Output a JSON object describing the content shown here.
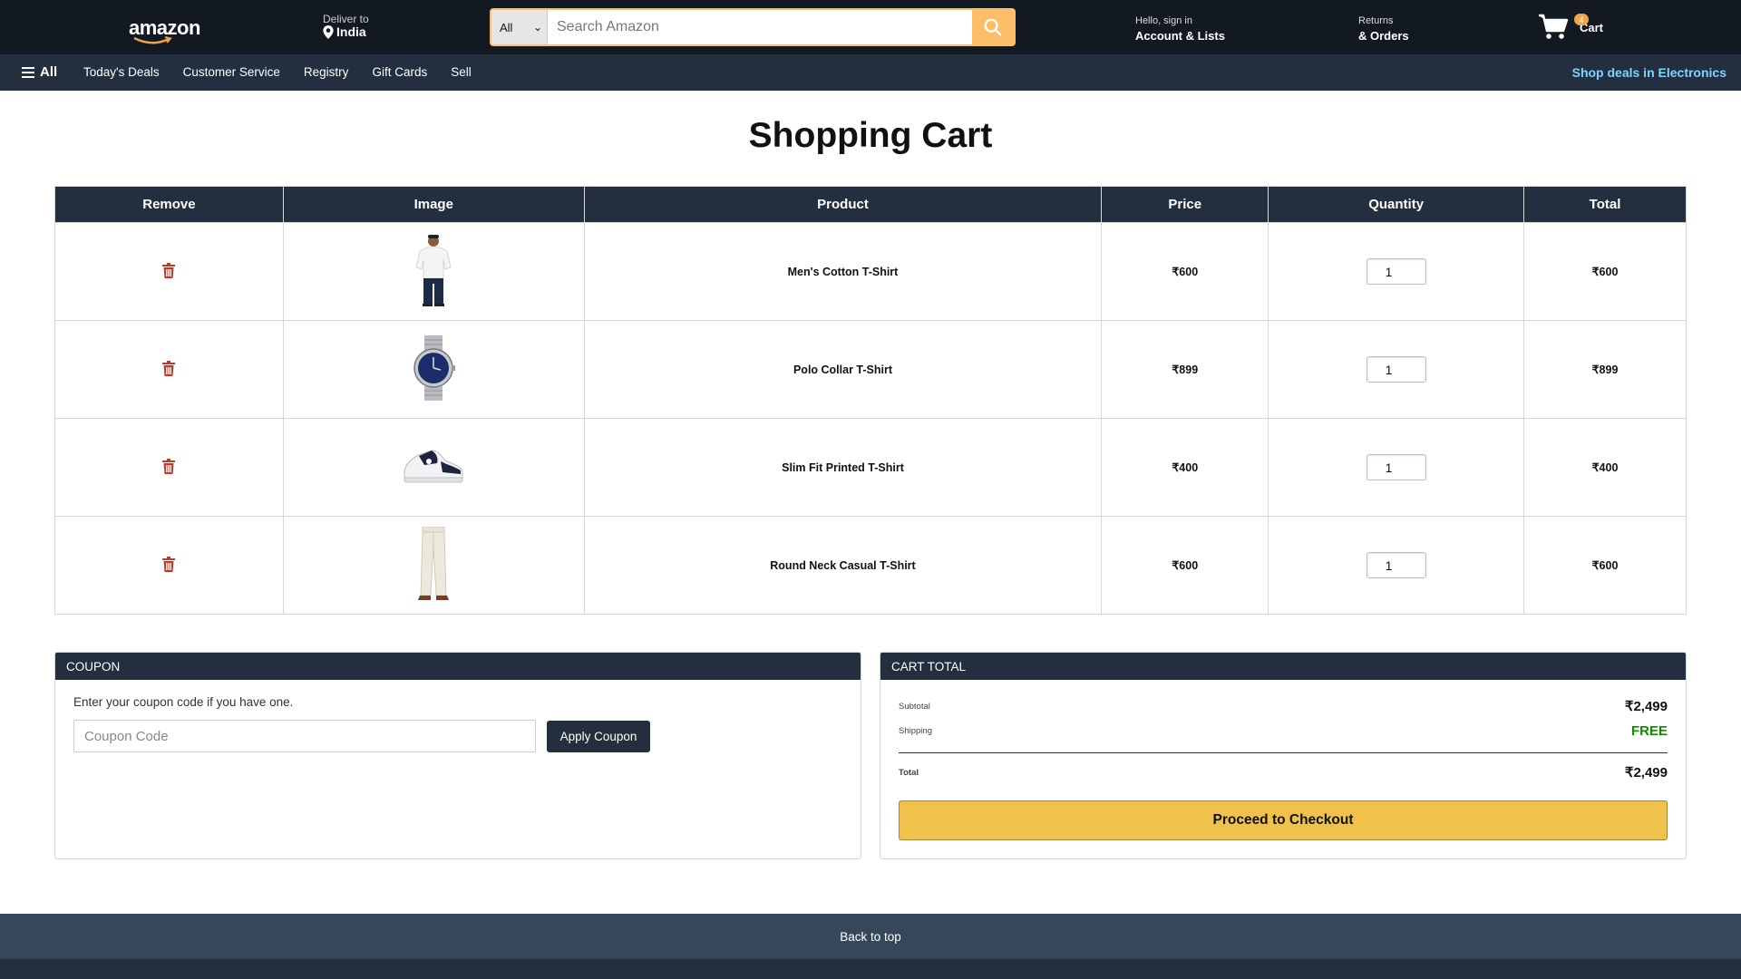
{
  "header": {
    "logo_text": "amazon",
    "deliver_small": "Deliver to",
    "deliver_location": "India",
    "search": {
      "category": "All",
      "placeholder": "Search Amazon"
    },
    "account_small": "Hello, sign in",
    "account_big": "Account & Lists",
    "returns_small": "Returns",
    "returns_big": "& Orders",
    "cart_count": "4",
    "cart_label": "Cart"
  },
  "subnav": {
    "all_label": "All",
    "links": [
      "Today's Deals",
      "Customer Service",
      "Registry",
      "Gift Cards",
      "Sell"
    ],
    "promo": "Shop deals in Electronics"
  },
  "page_title": "Shopping Cart",
  "table": {
    "headers": [
      "Remove",
      "Image",
      "Product",
      "Price",
      "Quantity",
      "Total"
    ],
    "rows": [
      {
        "product": "Men's Cotton T-Shirt",
        "price": "₹600",
        "quantity": "1",
        "total": "₹600",
        "image": "white-tshirt"
      },
      {
        "product": "Polo Collar T-Shirt",
        "price": "₹899",
        "quantity": "1",
        "total": "₹899",
        "image": "wrist-watch"
      },
      {
        "product": "Slim Fit Printed T-Shirt",
        "price": "₹400",
        "quantity": "1",
        "total": "₹400",
        "image": "sneaker"
      },
      {
        "product": "Round Neck Casual T-Shirt",
        "price": "₹600",
        "quantity": "1",
        "total": "₹600",
        "image": "trousers"
      }
    ]
  },
  "coupon": {
    "title": "COUPON",
    "hint": "Enter your coupon code if you have one.",
    "placeholder": "Coupon Code",
    "button": "Apply Coupon"
  },
  "cart_total": {
    "title": "CART TOTAL",
    "subtotal_label": "Subtotal",
    "subtotal_value": "₹2,499",
    "shipping_label": "Shipping",
    "shipping_value": "FREE",
    "total_label": "Total",
    "total_value": "₹2,499",
    "checkout_button": "Proceed to Checkout"
  },
  "footer": {
    "back_to_top": "Back to top"
  },
  "colors": {
    "nav": "#131921",
    "subnav": "#232f3e",
    "accent": "#febd69",
    "checkout": "#f0c14b",
    "remove": "#c0392b",
    "free": "#108a00"
  }
}
